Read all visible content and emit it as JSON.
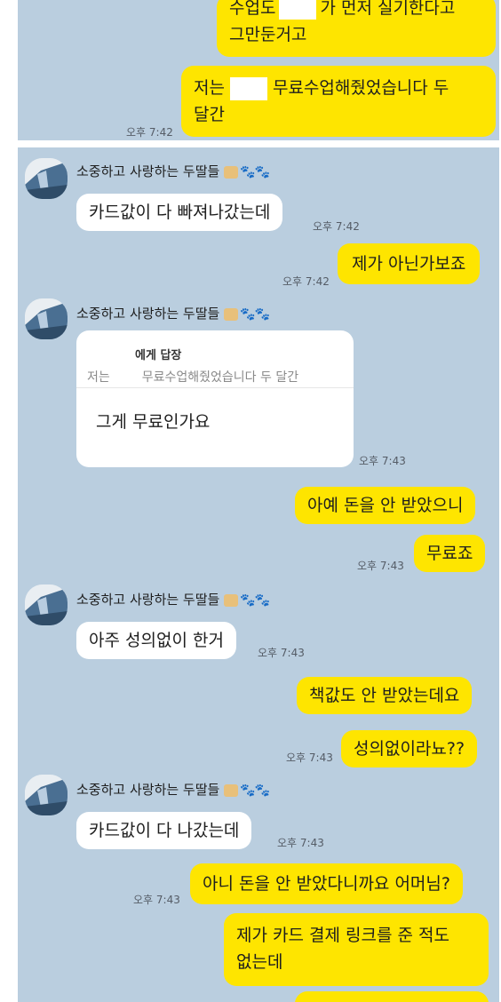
{
  "contact": {
    "name": "소중하고 사랑하는 두딸들",
    "name_emoji": "🐾🐾"
  },
  "panel1": {
    "messages": [
      {
        "line1_a": "수업도",
        "line1_b": "가 먼저 실기한다고",
        "line2": "그만둔거고"
      },
      {
        "line1_a": "저는",
        "line1_b": "무료수업해줬었습니다 두",
        "line2": "달간",
        "time": "오후 7:42"
      }
    ]
  },
  "panel2": {
    "m1": {
      "text": "카드값이 다 빠져나갔는데",
      "time": "오후 7:42"
    },
    "m2": {
      "text": "제가 아닌가보죠",
      "time": "오후 7:42"
    },
    "m3": {
      "reply_header": "에게 답장",
      "reply_quote_a": "저는",
      "reply_quote_b": "무료수업해줬었습니다 두 달간",
      "text": "그게 무료인가요",
      "time": "오후 7:43"
    },
    "m4": {
      "text": "아예 돈을 안 받았으니"
    },
    "m5": {
      "text": "무료죠",
      "time": "오후 7:43"
    },
    "m6": {
      "text": "아주 성의없이 한거",
      "time": "오후 7:43"
    },
    "m7": {
      "text": "책값도 안 받았는데요"
    },
    "m8": {
      "text": "성의없이라뇨??",
      "time": "오후 7:43"
    },
    "m9": {
      "text": "카드값이 다 나갔는데",
      "time": "오후 7:43"
    },
    "m10": {
      "text": "아니 돈을 안 받았다니까요 어머님?",
      "time": "오후 7:43"
    },
    "m11": {
      "line1": "제가 카드 결제 링크를 준 적도",
      "line2": "없는데"
    }
  }
}
